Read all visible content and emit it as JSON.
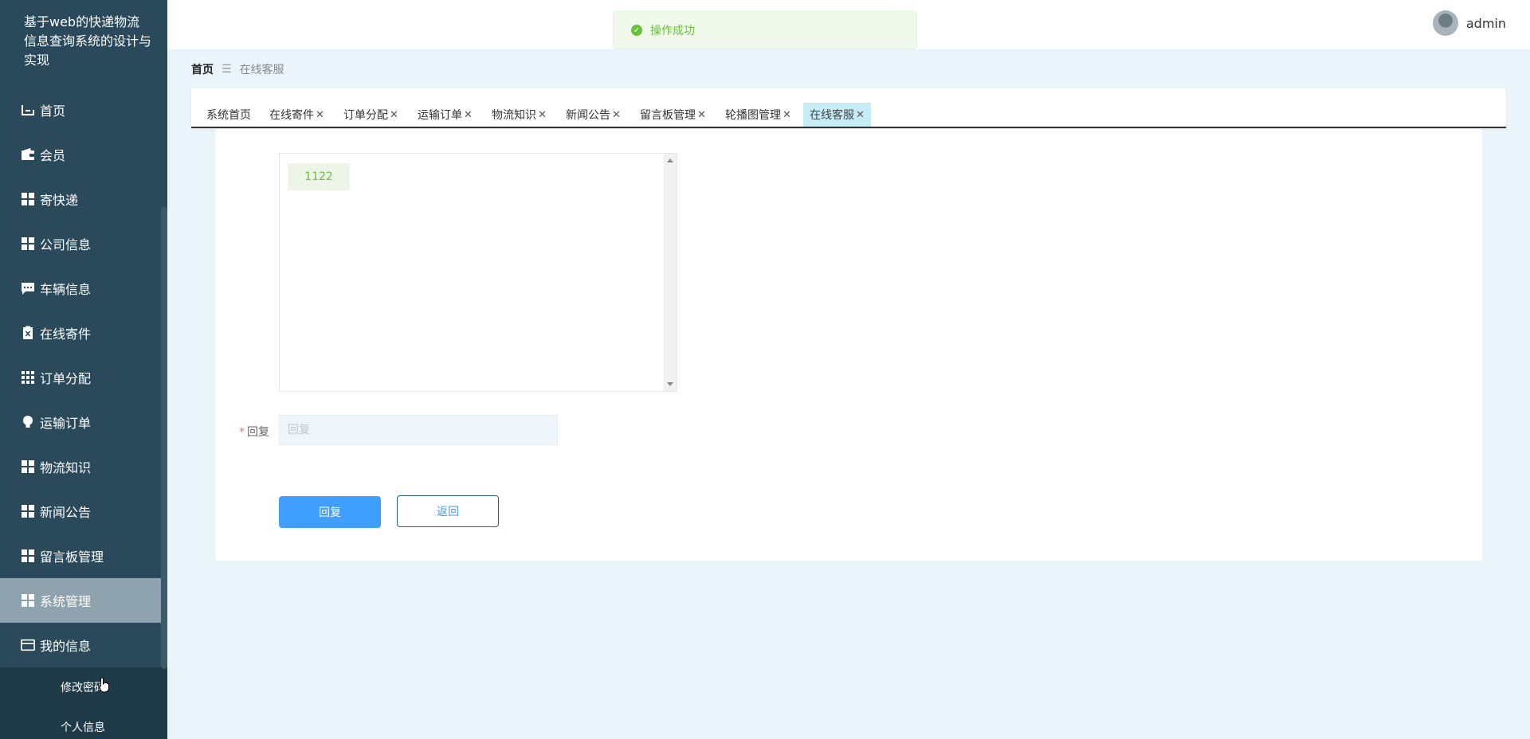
{
  "app": {
    "title": "基于web的快递物流信息查询系统的设计与实现"
  },
  "toast": {
    "message": "操作成功"
  },
  "user": {
    "name": "admin"
  },
  "sidebar": {
    "items": [
      {
        "label": "首页",
        "icon": "home-icon"
      },
      {
        "label": "会员",
        "icon": "wallet-icon"
      },
      {
        "label": "寄快递",
        "icon": "grid-icon"
      },
      {
        "label": "公司信息",
        "icon": "grid-icon"
      },
      {
        "label": "车辆信息",
        "icon": "chat-icon"
      },
      {
        "label": "在线寄件",
        "icon": "clipboard-icon"
      },
      {
        "label": "订单分配",
        "icon": "grid9-icon"
      },
      {
        "label": "运输订单",
        "icon": "bulb-icon"
      },
      {
        "label": "物流知识",
        "icon": "grid-icon"
      },
      {
        "label": "新闻公告",
        "icon": "grid-icon"
      },
      {
        "label": "留言板管理",
        "icon": "grid-icon"
      },
      {
        "label": "系统管理",
        "icon": "grid-icon",
        "active": true
      },
      {
        "label": "我的信息",
        "icon": "card-icon"
      }
    ],
    "subitems": [
      {
        "label": "修改密码"
      },
      {
        "label": "个人信息"
      }
    ]
  },
  "breadcrumb": {
    "home": "首页",
    "current": "在线客服"
  },
  "tabs": [
    {
      "label": "系统首页",
      "closable": false
    },
    {
      "label": "在线寄件",
      "closable": true
    },
    {
      "label": "订单分配",
      "closable": true
    },
    {
      "label": "运输订单",
      "closable": true
    },
    {
      "label": "物流知识",
      "closable": true
    },
    {
      "label": "新闻公告",
      "closable": true
    },
    {
      "label": "留言板管理",
      "closable": true
    },
    {
      "label": "轮播图管理",
      "closable": true
    },
    {
      "label": "在线客服",
      "closable": true,
      "active": true
    }
  ],
  "chat": {
    "messages": [
      {
        "text": "1122"
      }
    ]
  },
  "form": {
    "reply_label": "回复",
    "reply_placeholder": "回复",
    "reply_value": ""
  },
  "buttons": {
    "submit": "回复",
    "back": "返回"
  },
  "colors": {
    "sidebar": "#2a4a5c",
    "primary": "#409eff",
    "success": "#67c23a",
    "active_tab": "#c6ecf6"
  }
}
